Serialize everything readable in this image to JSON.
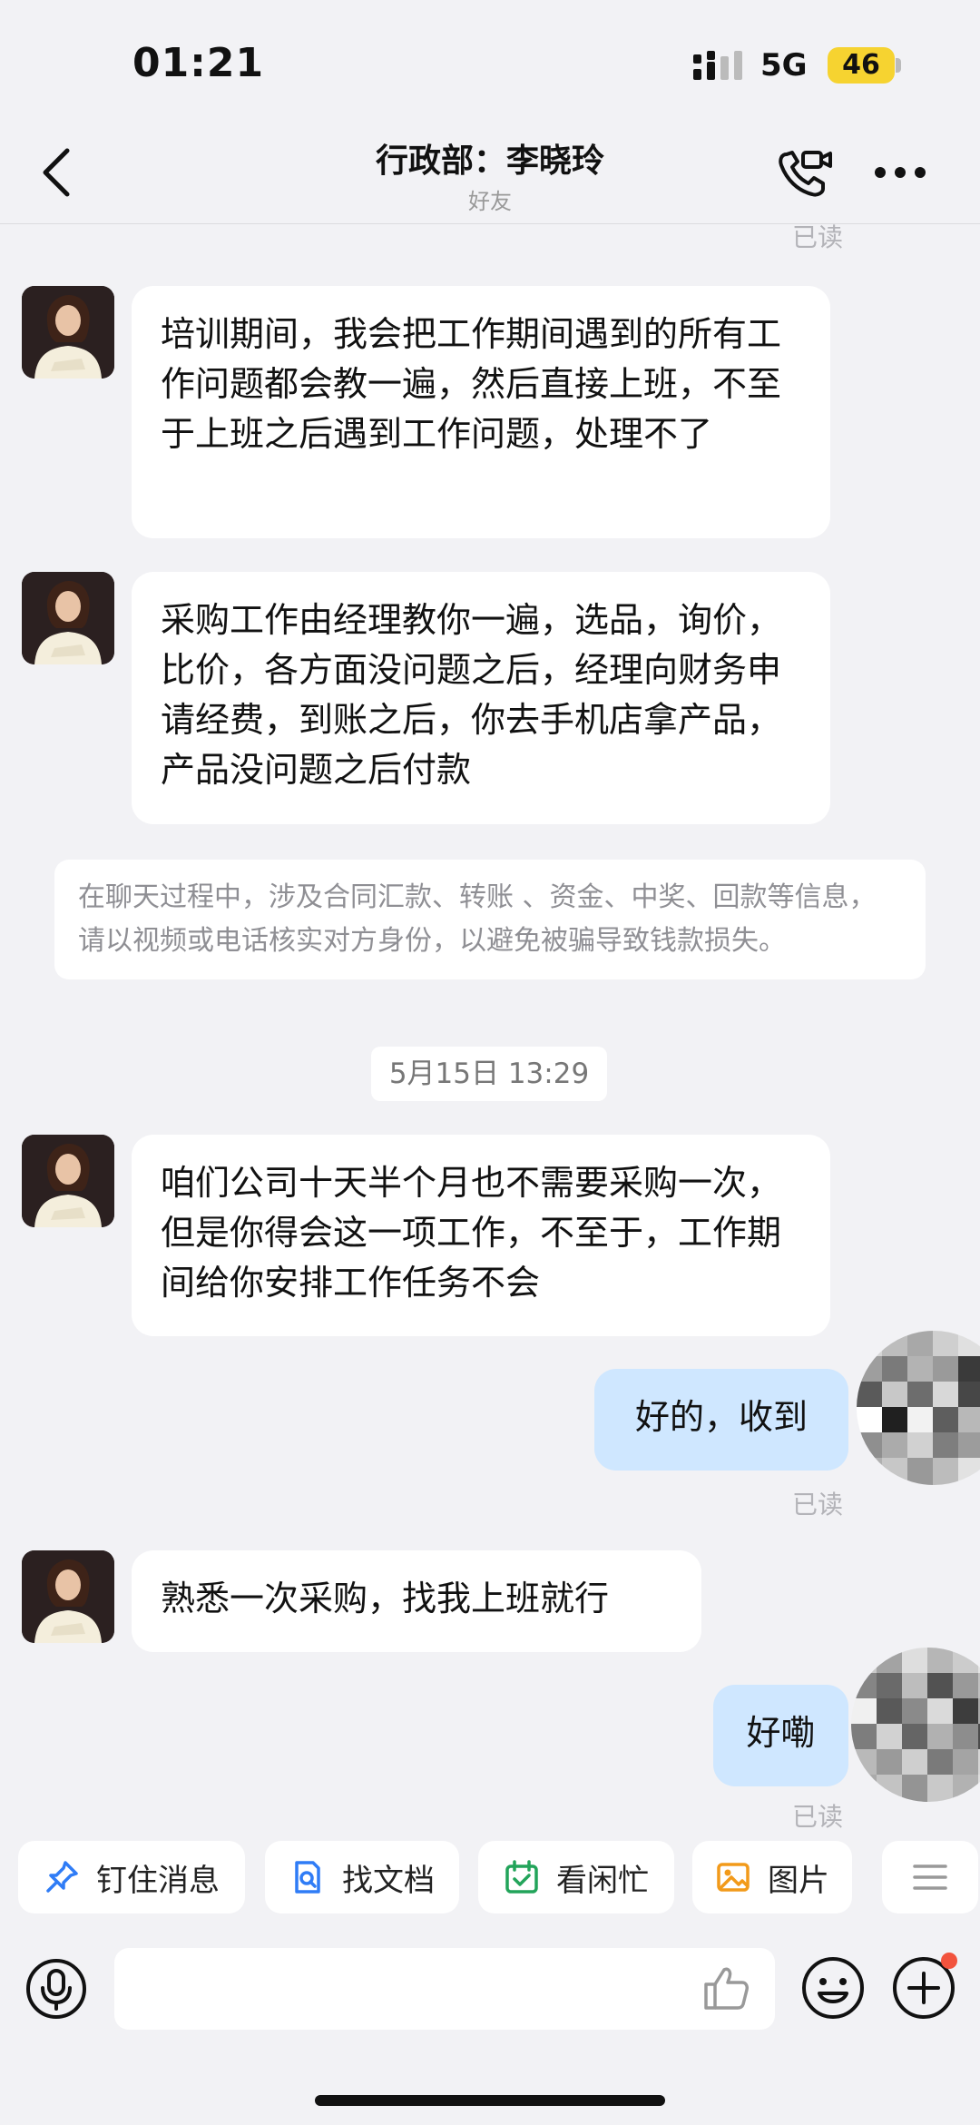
{
  "status_bar": {
    "time": "01:21",
    "network": "5G",
    "battery": "46"
  },
  "header": {
    "title": "行政部：李晓玲",
    "subtitle": "好友"
  },
  "read_label": "已读",
  "messages": {
    "m1": "培训期间，我会把工作期间遇到的所有工作问题都会教一遍，然后直接上班，不至于上班之后遇到工作问题，处理不了",
    "m2": "采购工作由经理教你一遍，选品，询价，比价，各方面没问题之后，经理向财务申请经费，到账之后，你去手机店拿产品，产品没问题之后付款",
    "notice": "在聊天过程中，涉及合同汇款、转账 、资金、中奖、回款等信息，请以视频或电话核实对方身份，以避免被骗导致钱款损失。",
    "timestamp": "5月15日 13:29",
    "m3": "咱们公司十天半个月也不需要采购一次，但是你得会这一项工作，不至于，工作期间给你安排工作任务不会",
    "mine1": "好的，收到",
    "m4": "熟悉一次采购，找我上班就行",
    "mine2": "好嘞"
  },
  "quick_actions": [
    {
      "label": "钉住消息",
      "icon": "pin-icon",
      "color": "#2f7cf6"
    },
    {
      "label": "找文档",
      "icon": "doc-search-icon",
      "color": "#2f7cf6"
    },
    {
      "label": "看闲忙",
      "icon": "calendar-check-icon",
      "color": "#22a45a"
    },
    {
      "label": "图片",
      "icon": "image-icon",
      "color": "#f29a1a"
    }
  ],
  "input": {
    "value": "",
    "placeholder": ""
  },
  "colors": {
    "mine_bubble": "#cfe7ff",
    "accent_blue": "#2f7cf6",
    "battery": "#f6d330",
    "badge_red": "#f2533d"
  }
}
